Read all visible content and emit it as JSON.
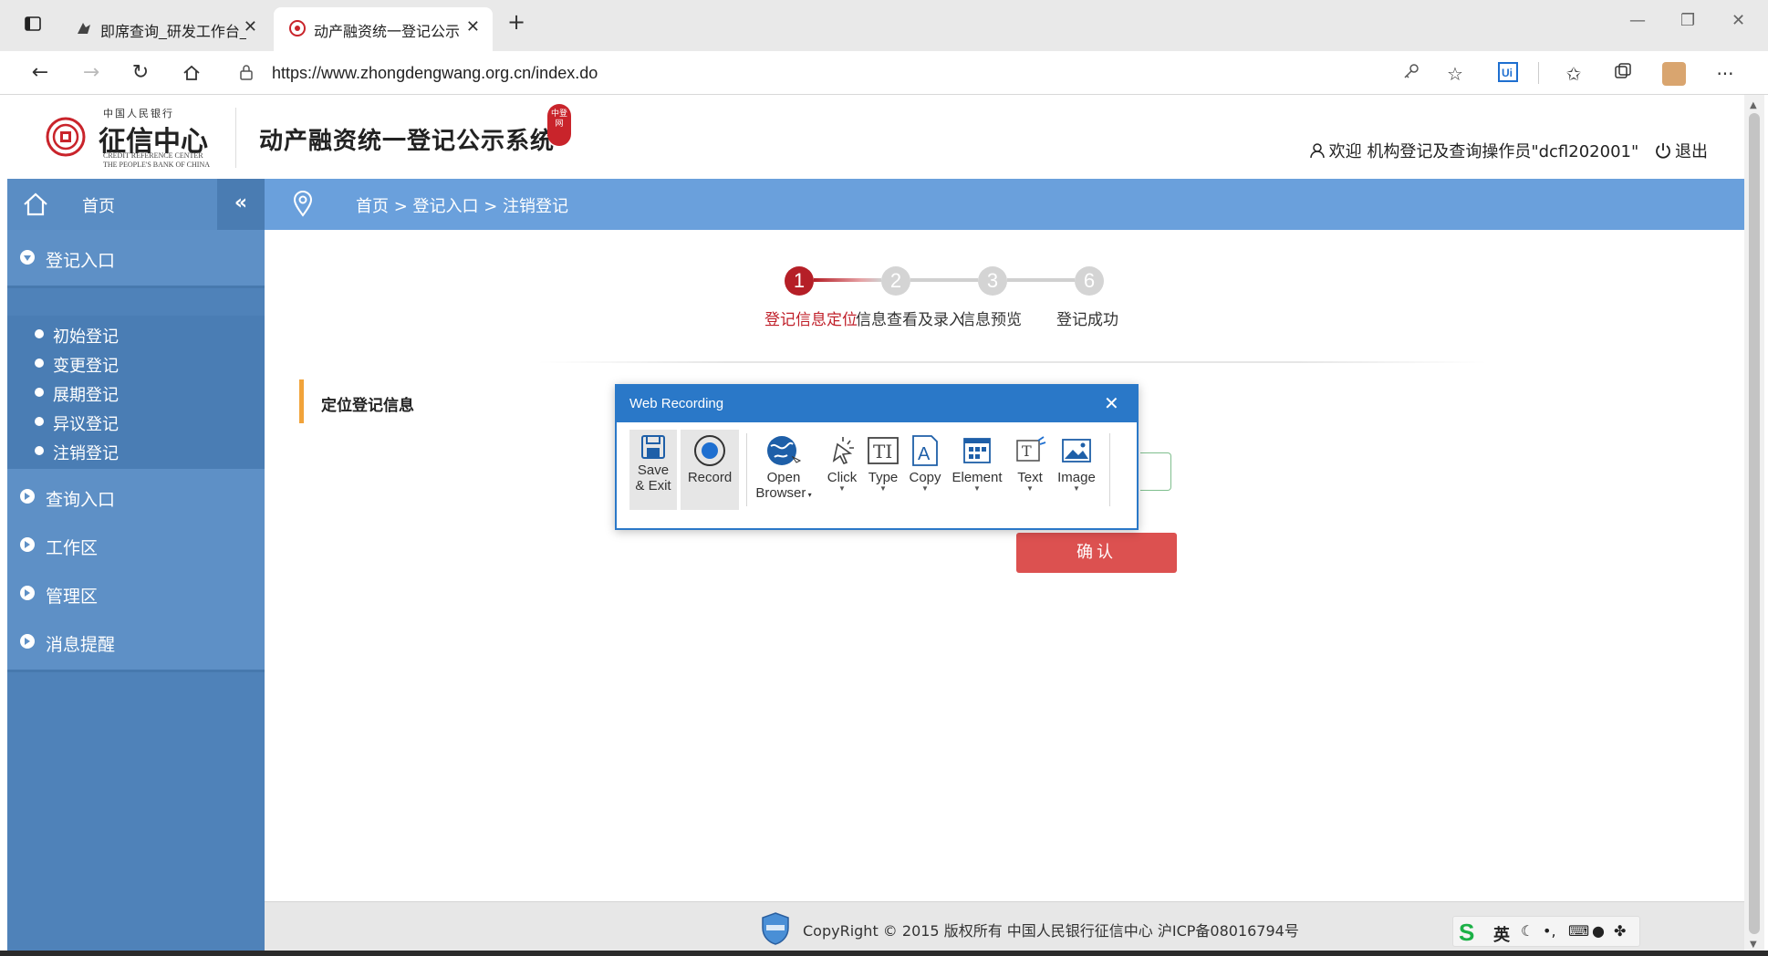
{
  "browser": {
    "tabs": [
      {
        "title": "即席查询_研发工作台_智能数据",
        "active": false
      },
      {
        "title": "动产融资统一登记公示系统",
        "active": true
      }
    ],
    "new_tab_glyph": "+",
    "close_glyph": "✕",
    "url": "https://www.zhongdengwang.org.cn/index.do"
  },
  "site": {
    "logo_small": "中国人民银行",
    "logo_name": "征信中心",
    "logo_en1": "CREDIT REFERENCE CENTER",
    "logo_en2": "THE PEOPLE'S BANK OF CHINA",
    "title": "动产融资统一登记公示系统",
    "seal_text": "中登网",
    "welcome": "欢迎 机构登记及查询操作员\"dcfl202001\"",
    "logout": "退出"
  },
  "sidebar": {
    "home": "首页",
    "groups": [
      {
        "label": "登记入口",
        "open": true,
        "items": [
          "初始登记",
          "变更登记",
          "展期登记",
          "异议登记",
          "注销登记"
        ]
      },
      {
        "label": "查询入口",
        "open": false
      },
      {
        "label": "工作区",
        "open": false
      },
      {
        "label": "管理区",
        "open": false
      },
      {
        "label": "消息提醒",
        "open": false
      }
    ]
  },
  "breadcrumb": "首页 > 登记入口 > 注销登记",
  "steps": [
    {
      "num": "1",
      "label": "登记信息定位",
      "active": true
    },
    {
      "num": "2",
      "label": "信息查看及录入",
      "active": false
    },
    {
      "num": "3",
      "label": "信息预览",
      "active": false
    },
    {
      "num": "6",
      "label": "登记成功",
      "active": false
    }
  ],
  "section_title": "定位登记信息",
  "confirm_label": "确认",
  "footer": "CopyRight © 2015 版权所有 中国人民银行征信中心 沪ICP备08016794号",
  "ime": {
    "logo": "S",
    "lang": "英"
  },
  "recorder": {
    "title": "Web Recording",
    "buttons": [
      {
        "l1": "Save",
        "l2": "& Exit",
        "icon": "save-icon"
      },
      {
        "l1": "Record",
        "l2": "",
        "icon": "record-icon"
      },
      {
        "l1": "Open",
        "l2": "Browser",
        "icon": "globe-icon"
      },
      {
        "l1": "Click",
        "l2": "",
        "icon": "click-icon"
      },
      {
        "l1": "Type",
        "l2": "",
        "icon": "type-icon"
      },
      {
        "l1": "Copy",
        "l2": "",
        "icon": "copy-icon"
      },
      {
        "l1": "Element",
        "l2": "",
        "icon": "element-icon"
      },
      {
        "l1": "Text",
        "l2": "",
        "icon": "text-icon"
      },
      {
        "l1": "Image",
        "l2": "",
        "icon": "image-icon"
      }
    ]
  },
  "colors": {
    "sidebar": "#4f82b9",
    "breadcrumb_bar": "#6aa0dc",
    "step_active": "#b51f27",
    "confirm": "#dc5150",
    "recorder_accent": "#2a78c8",
    "section_accent": "#f1a33a"
  }
}
